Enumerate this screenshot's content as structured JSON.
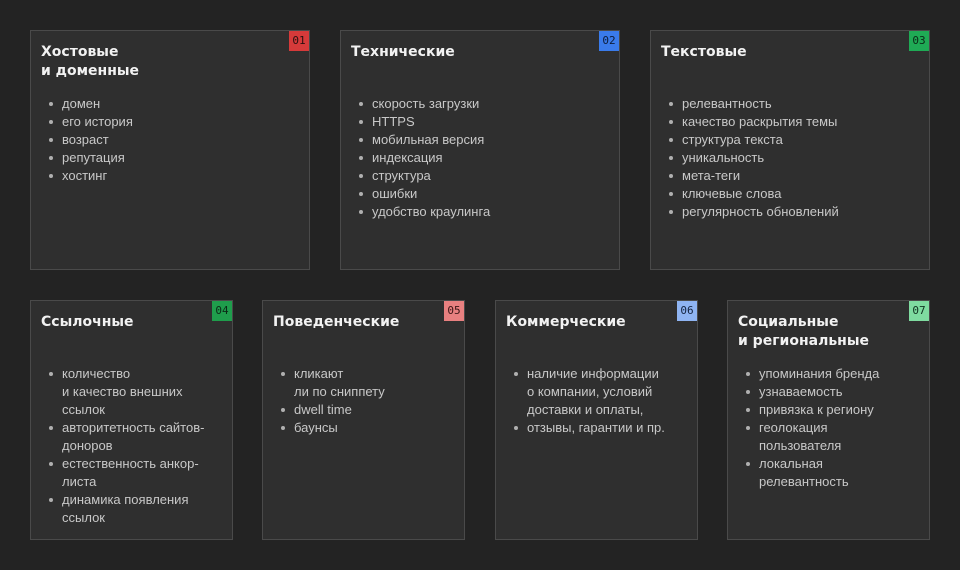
{
  "cards": [
    {
      "number": "01",
      "badge_bg": "#d63a3a",
      "badge_fg": "#2a1010",
      "title_lines": [
        "Хостовые",
        "и  доменные"
      ],
      "items": [
        [
          "домен"
        ],
        [
          "его история"
        ],
        [
          "возраст"
        ],
        [
          "репутация"
        ],
        [
          "хостинг"
        ]
      ]
    },
    {
      "number": "02",
      "badge_bg": "#3a7bea",
      "badge_fg": "#0e1d3a",
      "title_lines": [
        "Технические"
      ],
      "items": [
        [
          "скорость загрузки"
        ],
        [
          "HTTPS"
        ],
        [
          "мобильная версия"
        ],
        [
          "индексация"
        ],
        [
          "структура"
        ],
        [
          "ошибки"
        ],
        [
          "удобство краулинга"
        ]
      ]
    },
    {
      "number": "03",
      "badge_bg": "#1faa55",
      "badge_fg": "#0b2a17",
      "title_lines": [
        "Текстовые"
      ],
      "items": [
        [
          "релевантность"
        ],
        [
          "качество раскрытия темы"
        ],
        [
          "структура текста"
        ],
        [
          "уникальность"
        ],
        [
          "мета-теги"
        ],
        [
          "ключевые слова"
        ],
        [
          "регулярность обновлений"
        ]
      ]
    },
    {
      "number": "04",
      "badge_bg": "#1f9d4c",
      "badge_fg": "#0b2a17",
      "title_lines": [
        "Ссылочные"
      ],
      "items": [
        [
          "количество",
          "и качество внешних",
          "ссылок"
        ],
        [
          "авторитетность сайтов-",
          "доноров"
        ],
        [
          "естественность анкор-",
          "листа"
        ],
        [
          "динамика появления",
          "ссылок"
        ]
      ]
    },
    {
      "number": "05",
      "badge_bg": "#e88080",
      "badge_fg": "#3a1515",
      "title_lines": [
        "Поведенческие"
      ],
      "items": [
        [
          "кликают",
          "ли по сниппету"
        ],
        [
          "dwell time"
        ],
        [
          "баунсы"
        ]
      ]
    },
    {
      "number": "06",
      "badge_bg": "#8fb4f2",
      "badge_fg": "#14233f",
      "title_lines": [
        "Коммерческие"
      ],
      "items": [
        [
          "наличие информации",
          "о компании, условий",
          "доставки и оплаты,"
        ],
        [
          "отзывы, гарантии и пр."
        ]
      ]
    },
    {
      "number": "07",
      "badge_bg": "#7fdba0",
      "badge_fg": "#113321",
      "title_lines": [
        "Социальные",
        "и  региональные"
      ],
      "items": [
        [
          "упоминания бренда"
        ],
        [
          "узнаваемость"
        ],
        [
          "привязка к региону"
        ],
        [
          "геолокация",
          "пользователя"
        ],
        [
          "локальная",
          "релевантность"
        ]
      ]
    }
  ]
}
